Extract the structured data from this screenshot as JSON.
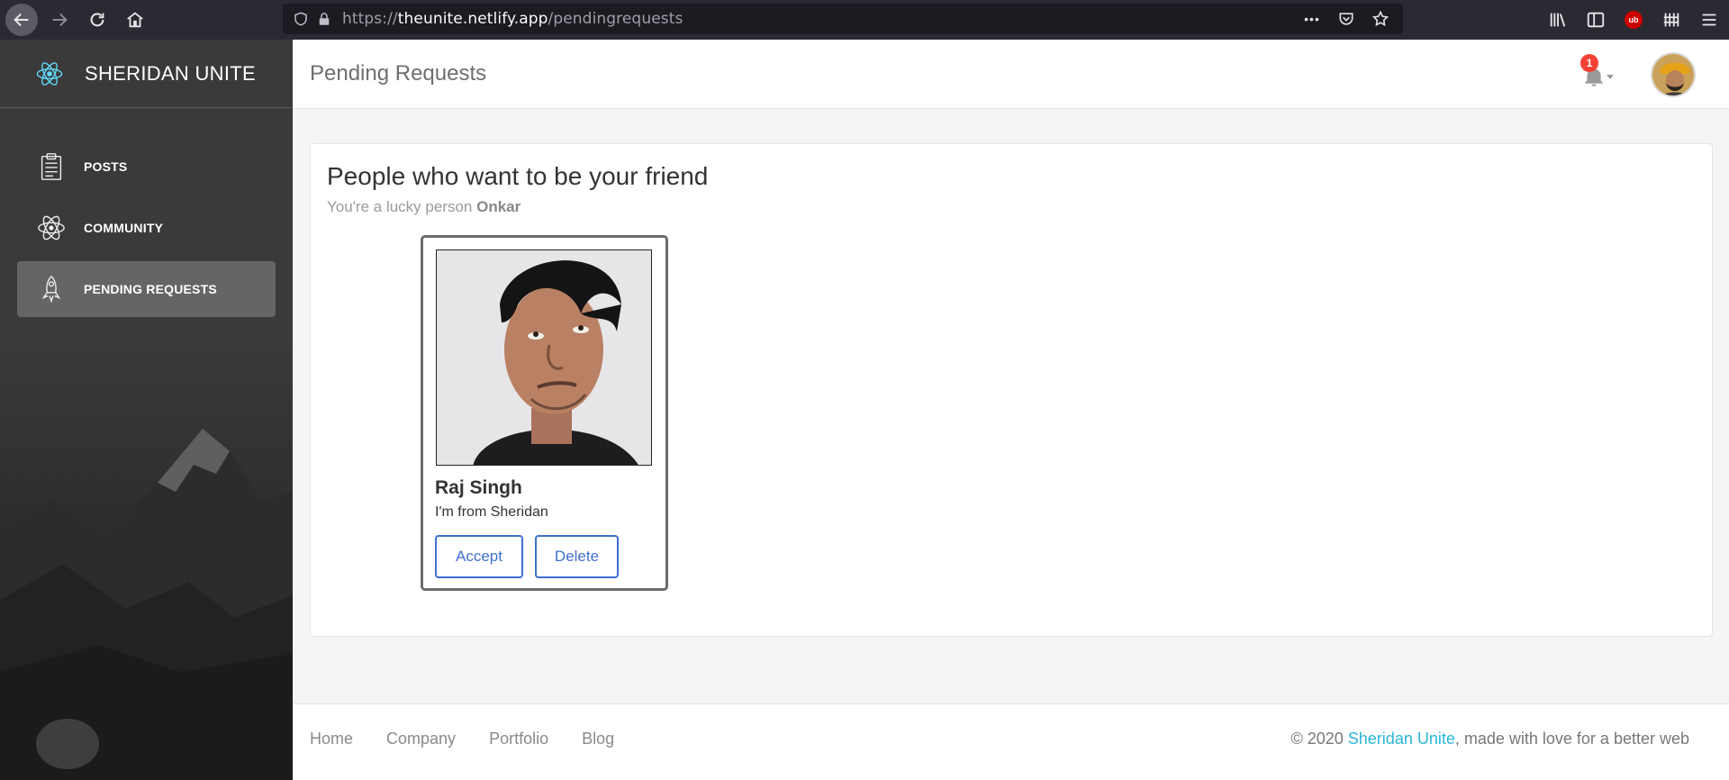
{
  "browser": {
    "url_prefix": "https://",
    "url_host": "theunite.netlify.app",
    "url_path": "/pendingrequests",
    "more_label": "•••"
  },
  "sidebar": {
    "brand": "SHERIDAN UNITE",
    "items": [
      {
        "label": "POSTS",
        "icon": "clipboard-icon",
        "active": false
      },
      {
        "label": "COMMUNITY",
        "icon": "atom-icon",
        "active": false
      },
      {
        "label": "PENDING REQUESTS",
        "icon": "rocket-icon",
        "active": true
      }
    ]
  },
  "header": {
    "title": "Pending Requests",
    "notification_count": "1"
  },
  "main": {
    "title": "People who want to be your friend",
    "subtitle_prefix": "You're a lucky person ",
    "subtitle_name": "Onkar",
    "requests": [
      {
        "name": "Raj Singh",
        "bio": "I'm from Sheridan",
        "accept_label": "Accept",
        "delete_label": "Delete"
      }
    ]
  },
  "footer": {
    "links": [
      "Home",
      "Company",
      "Portfolio",
      "Blog"
    ],
    "copyright_prefix": "© 2020 ",
    "copyright_brand": "Sheridan Unite",
    "copyright_suffix": ", made with love for a better web"
  },
  "colors": {
    "accent": "#61dafb",
    "button": "#3f6fcf",
    "badge": "#f44336",
    "link": "#29b6d8"
  }
}
